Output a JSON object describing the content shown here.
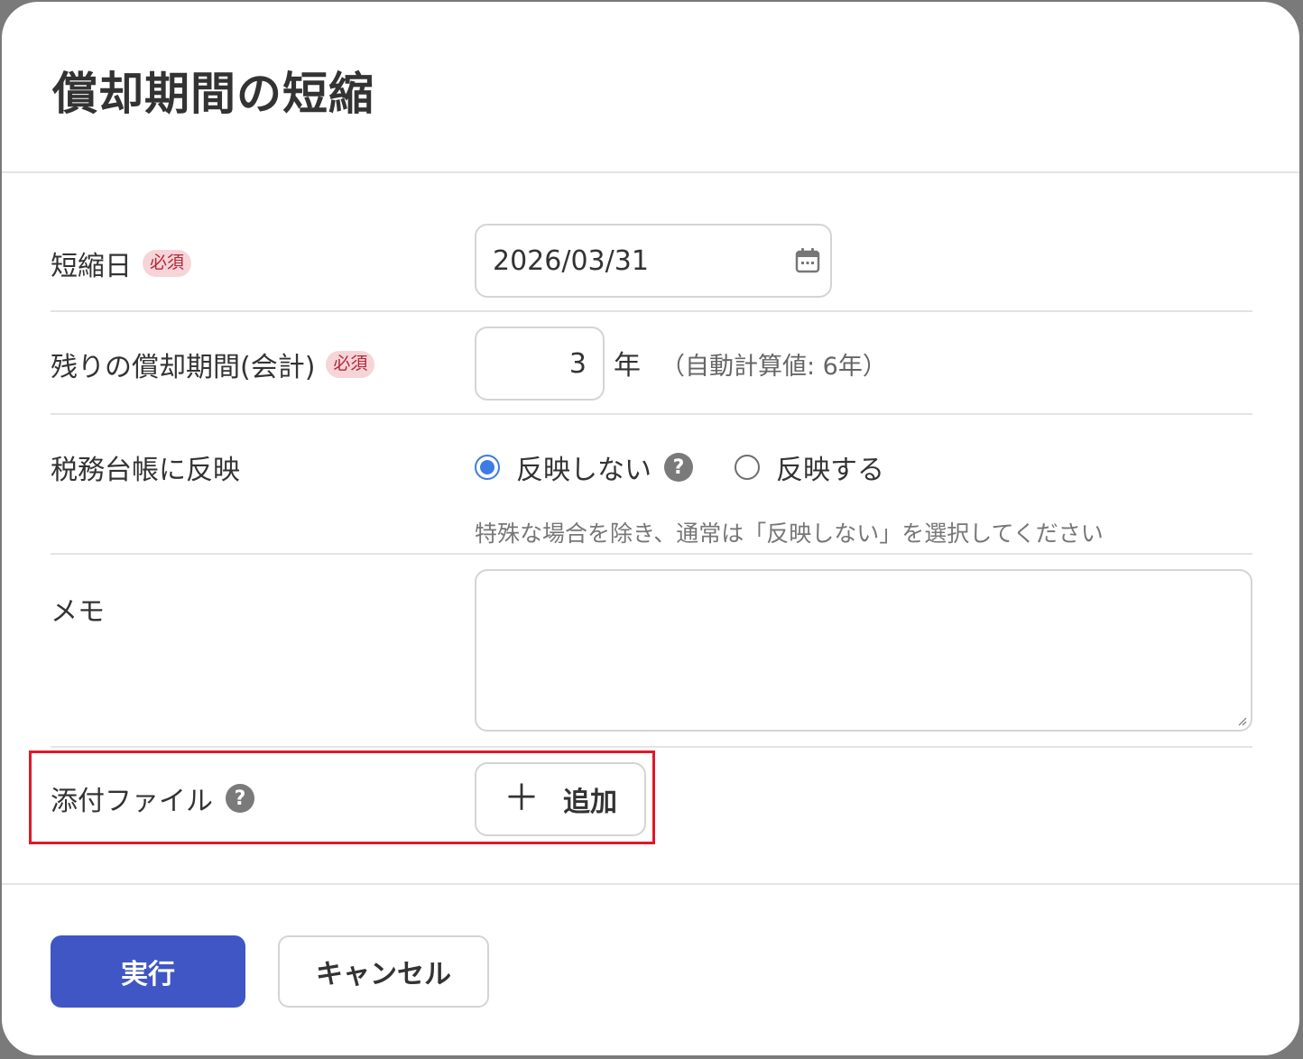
{
  "dialog": {
    "title": "償却期間の短縮"
  },
  "form": {
    "shortening_date": {
      "label": "短縮日",
      "required_badge": "必須",
      "value": "2026/03/31"
    },
    "remaining_period": {
      "label": "残りの償却期間(会計)",
      "required_badge": "必須",
      "value": "3",
      "unit": "年",
      "auto_note": "（自動計算値: 6年）"
    },
    "tax_ledger": {
      "label": "税務台帳に反映",
      "options": [
        {
          "label": "反映しない",
          "selected": true
        },
        {
          "label": "反映する",
          "selected": false
        }
      ],
      "note": "特殊な場合を除き、通常は「反映しない」を選択してください"
    },
    "memo": {
      "label": "メモ",
      "value": ""
    },
    "attachments": {
      "label": "添付ファイル",
      "add_label": "追加"
    }
  },
  "footer": {
    "execute_label": "実行",
    "cancel_label": "キャンセル"
  },
  "colors": {
    "primary": "#3f56c4",
    "radio_selected": "#3d7be6",
    "badge_text": "#b2283a",
    "badge_bg": "#f6d4d8",
    "highlight": "#e0192a"
  }
}
